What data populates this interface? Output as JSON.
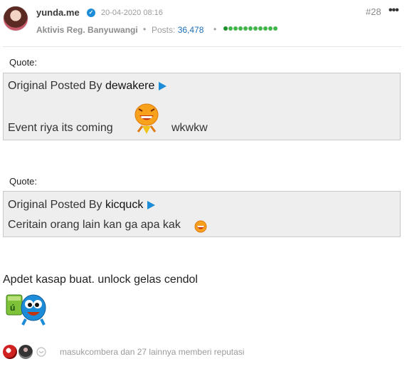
{
  "post": {
    "username": "yunda.me",
    "date": "20-04-2020 08:16",
    "post_number": "#28",
    "more_label": "•••",
    "rank": "Aktivis Reg. Banyuwangi",
    "posts_label": "Posts:",
    "posts_count": "36,478",
    "reputation_dots": 11
  },
  "quotes": [
    {
      "label": "Quote:",
      "prefix": "Original Posted By",
      "author": "dewakere",
      "text": "Event riya its coming",
      "emoji": "laughing-emoticon",
      "suffix": "wkwkw"
    },
    {
      "label": "Quote:",
      "prefix": "Original Posted By",
      "author": "kicquck",
      "text": "Ceritain orang lain kan ga apa kak",
      "emoji": "laughing-emoticon"
    }
  ],
  "body": {
    "text": "Apdet kasap buat. unlock gelas cendol",
    "emoji": "cendol-emoticon"
  },
  "footer": {
    "reputation_text": "masukcombera dan 27 lainnya memberi reputasi"
  },
  "colors": {
    "link": "#1d8cd8",
    "reputation": "#3fb54a",
    "quote_bg": "#eeeeee"
  }
}
